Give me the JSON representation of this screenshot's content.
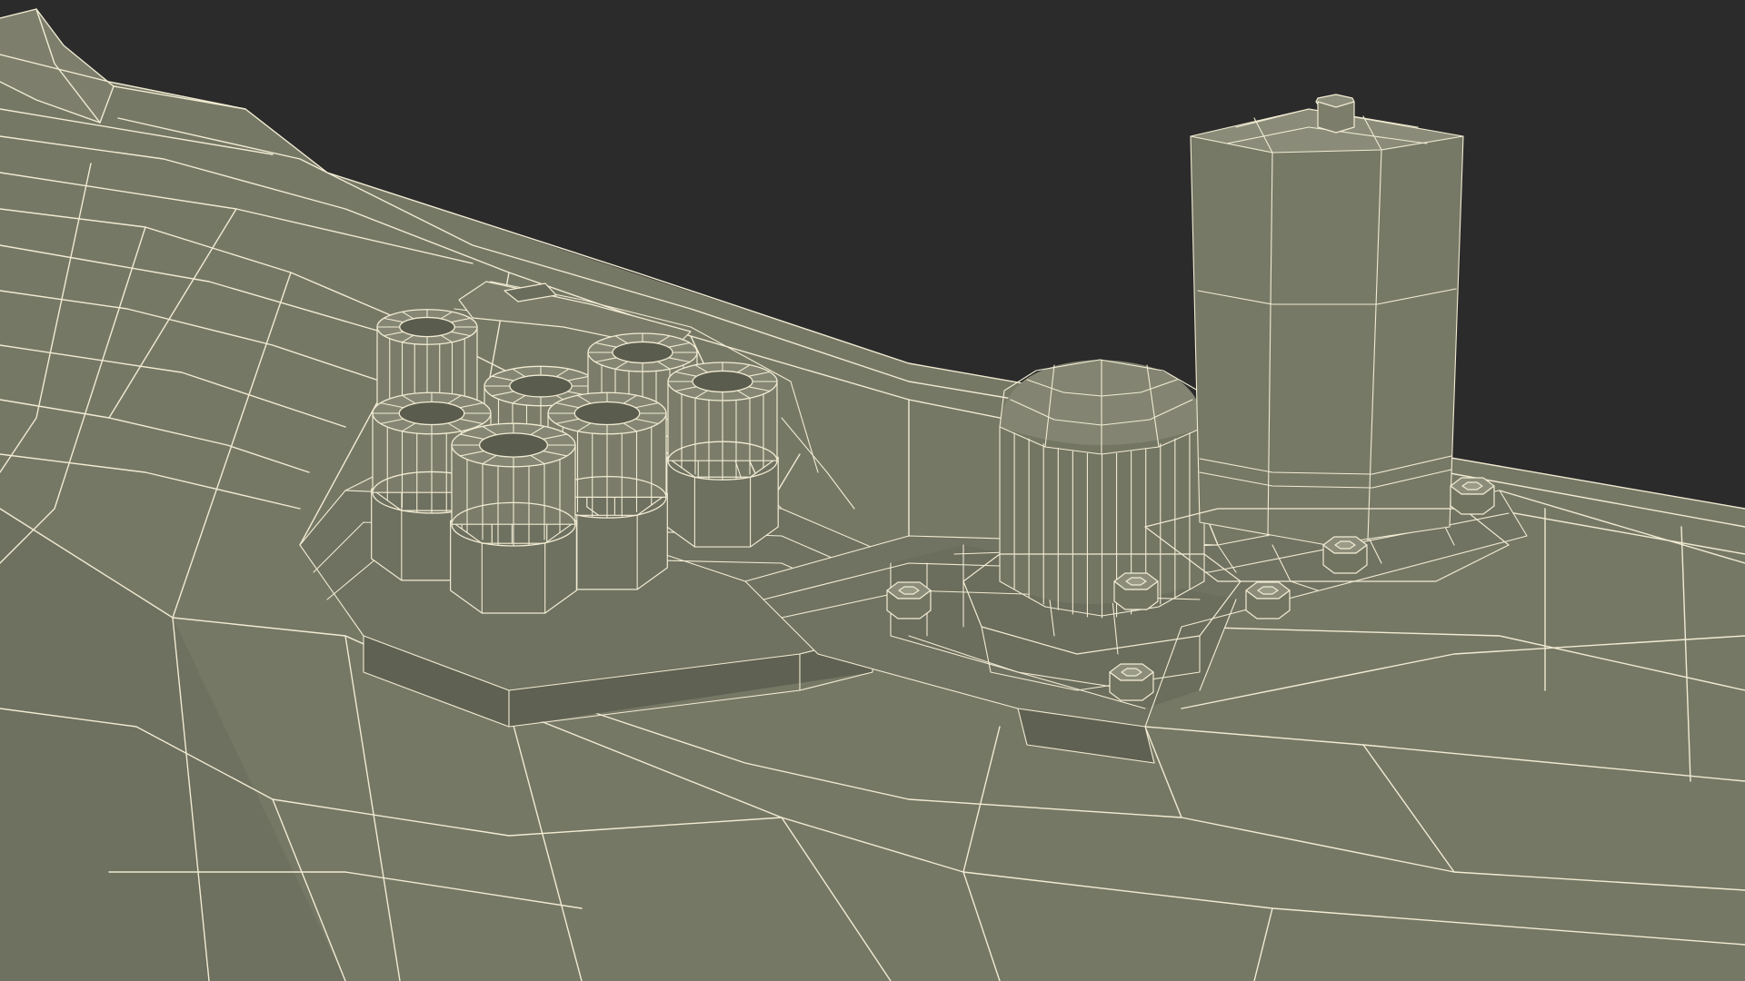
{
  "scene": {
    "background_color": "#2b2b2b",
    "surface_color": "#767866",
    "surface_shadow_color": "#5f6152",
    "surface_highlight_color": "#8a8c78",
    "wire_color": "#f1ebd2",
    "render_mode": "wireframe-over-shaded"
  }
}
